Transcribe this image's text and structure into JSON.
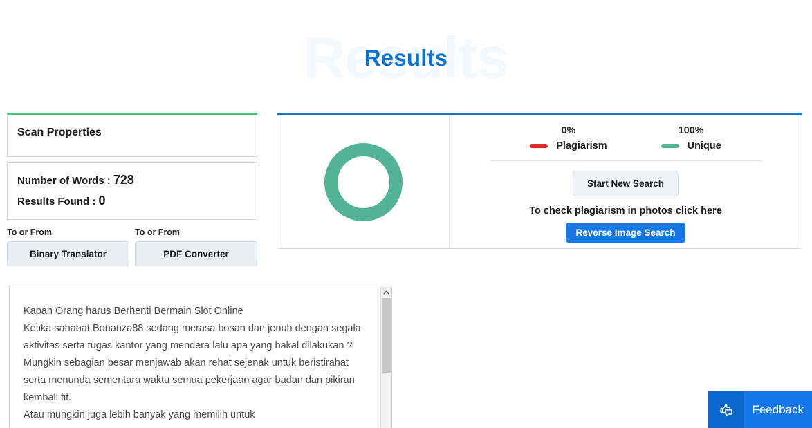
{
  "header": {
    "title": "Results",
    "ghost_title": "Results",
    "accent_color": "#0a72d6"
  },
  "scan_properties": {
    "title": "Scan Properties",
    "accent_color": "#35c877",
    "stats": [
      {
        "label": "Number of Words :",
        "value": "728"
      },
      {
        "label": "Results Found :",
        "value": "0"
      }
    ],
    "tools": [
      {
        "label": "To or From",
        "button": "Binary Translator"
      },
      {
        "label": "To or From",
        "button": "PDF Converter"
      }
    ]
  },
  "results_panel": {
    "accent_color": "#1077d8",
    "chart_data": {
      "type": "pie",
      "title": "",
      "categories": [
        "Plagiarism",
        "Unique"
      ],
      "values": [
        0,
        100
      ],
      "colors": [
        "#e02b29",
        "#52b495"
      ],
      "legend_position": "right",
      "unit": "%"
    },
    "legend": [
      {
        "percent": "0%",
        "name": "Plagiarism",
        "color": "#e02b29"
      },
      {
        "percent": "100%",
        "name": "Unique",
        "color": "#52b495"
      }
    ],
    "start_new_search": "Start New Search",
    "photo_hint": "To check plagiarism in photos click here",
    "reverse_image_search": "Reverse Image Search"
  },
  "text_box": {
    "content": "Kapan Orang harus Berhenti Bermain Slot Online\nKetika sahabat Bonanza88 sedang merasa bosan dan jenuh dengan segala aktivitas serta tugas kantor yang mendera lalu apa yang bakal dilakukan ?\nMungkin sebagian besar menjawab akan rehat sejenak untuk beristirahat serta menunda sementara waktu semua pekerjaan agar badan dan pikiran kembali fit.\nAtau mungkin juga lebih banyak yang memilih untuk"
  },
  "feedback": {
    "label": "Feedback",
    "icon": "thumbs-up-comment-icon",
    "color": "#1577e8"
  }
}
